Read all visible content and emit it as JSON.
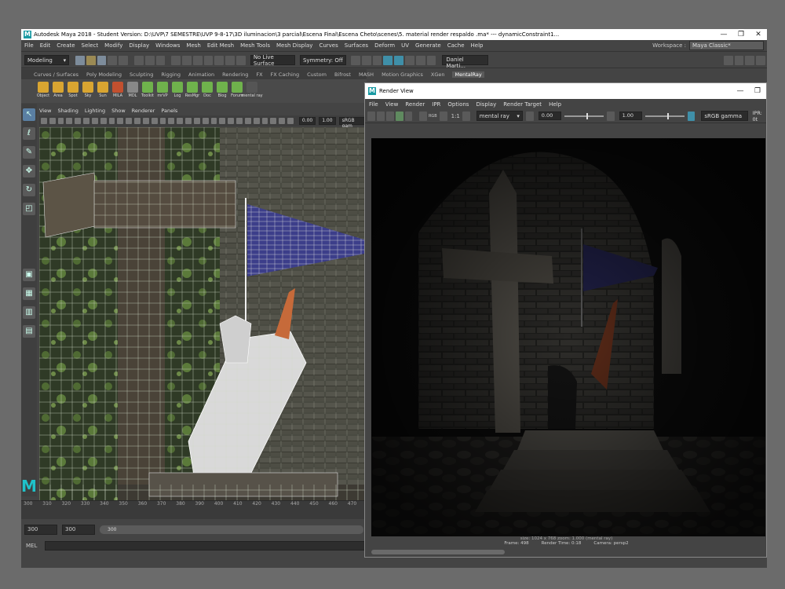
{
  "window": {
    "logo": "M",
    "title": "Autodesk Maya 2018 - Student Version: D:\\UVP\\7 SEMESTRE\\UVP 9-8-17\\3D iluminacion\\3 parcial\\Escena Final\\Escena Cheto\\scenes\\5. material render respaldo .ma* --- dynamicConstraint1...",
    "min": "—",
    "max": "❐",
    "close": "✕"
  },
  "menu": [
    "File",
    "Edit",
    "Create",
    "Select",
    "Modify",
    "Display",
    "Windows",
    "Mesh",
    "Edit Mesh",
    "Mesh Tools",
    "Mesh Display",
    "Curves",
    "Surfaces",
    "Deform",
    "UV",
    "Generate",
    "Cache",
    "Help"
  ],
  "workspace": {
    "label": "Workspace :",
    "value": "Maya Classic*"
  },
  "status": {
    "mode": "Modeling",
    "live": "No Live Surface",
    "symmetry": "Symmetry: Off",
    "user": "Daniel Marti..."
  },
  "shelf_tabs": [
    "Curves / Surfaces",
    "Poly Modeling",
    "Sculpting",
    "Rigging",
    "Animation",
    "Rendering",
    "FX",
    "FX Caching",
    "Custom",
    "Bifrost",
    "MASH",
    "Motion Graphics",
    "XGen",
    "MentalRay"
  ],
  "shelf_active": "MentalRay",
  "shelf_items": [
    {
      "name": "Object",
      "color": "#d9a531"
    },
    {
      "name": "Area",
      "color": "#d9a531"
    },
    {
      "name": "Spot",
      "color": "#d9a531"
    },
    {
      "name": "Sky",
      "color": "#d9a531"
    },
    {
      "name": "Sun",
      "color": "#d9a531"
    },
    {
      "name": "MILA",
      "color": "#c2502f"
    },
    {
      "name": "MDL",
      "color": "#888"
    },
    {
      "name": "Toolkit",
      "color": "#6fb24c"
    },
    {
      "name": "mrVP",
      "color": "#6fb24c"
    },
    {
      "name": "Log",
      "color": "#6fb24c"
    },
    {
      "name": "ResMgr",
      "color": "#6fb24c"
    },
    {
      "name": "Doc",
      "color": "#6fb24c"
    },
    {
      "name": "Blog",
      "color": "#6fb24c"
    },
    {
      "name": "Forum",
      "color": "#6fb24c"
    },
    {
      "name": "mental ray",
      "color": "#555"
    }
  ],
  "viewport": {
    "menu": [
      "View",
      "Shading",
      "Lighting",
      "Show",
      "Renderer",
      "Panels"
    ],
    "val1": "0.00",
    "val2": "1.00",
    "gamma": "sRGB gam"
  },
  "timeline": {
    "ticks": [
      "300",
      "310",
      "320",
      "330",
      "340",
      "350",
      "360",
      "370",
      "380",
      "390",
      "400",
      "410",
      "420",
      "430",
      "440",
      "450",
      "460",
      "470"
    ],
    "start": "300",
    "start2": "300",
    "range_label": "300"
  },
  "mel": "MEL",
  "render_view": {
    "title": "Render View",
    "menu": [
      "File",
      "View",
      "Render",
      "IPR",
      "Options",
      "Display",
      "Render Target",
      "Help"
    ],
    "renderer": "mental ray",
    "ratio": "1:1",
    "rgb": "RGB",
    "exposure": "0.00",
    "gamma_val": "1.00",
    "colorspace": "sRGB gamma",
    "ipr": "IPR: 0t",
    "size_info": "size: 1024 x 768  zoom: 1.000     (mental ray)",
    "frame": "Frame: 498",
    "render_time": "Render Time: 0:18",
    "camera": "Camera: persp2"
  }
}
